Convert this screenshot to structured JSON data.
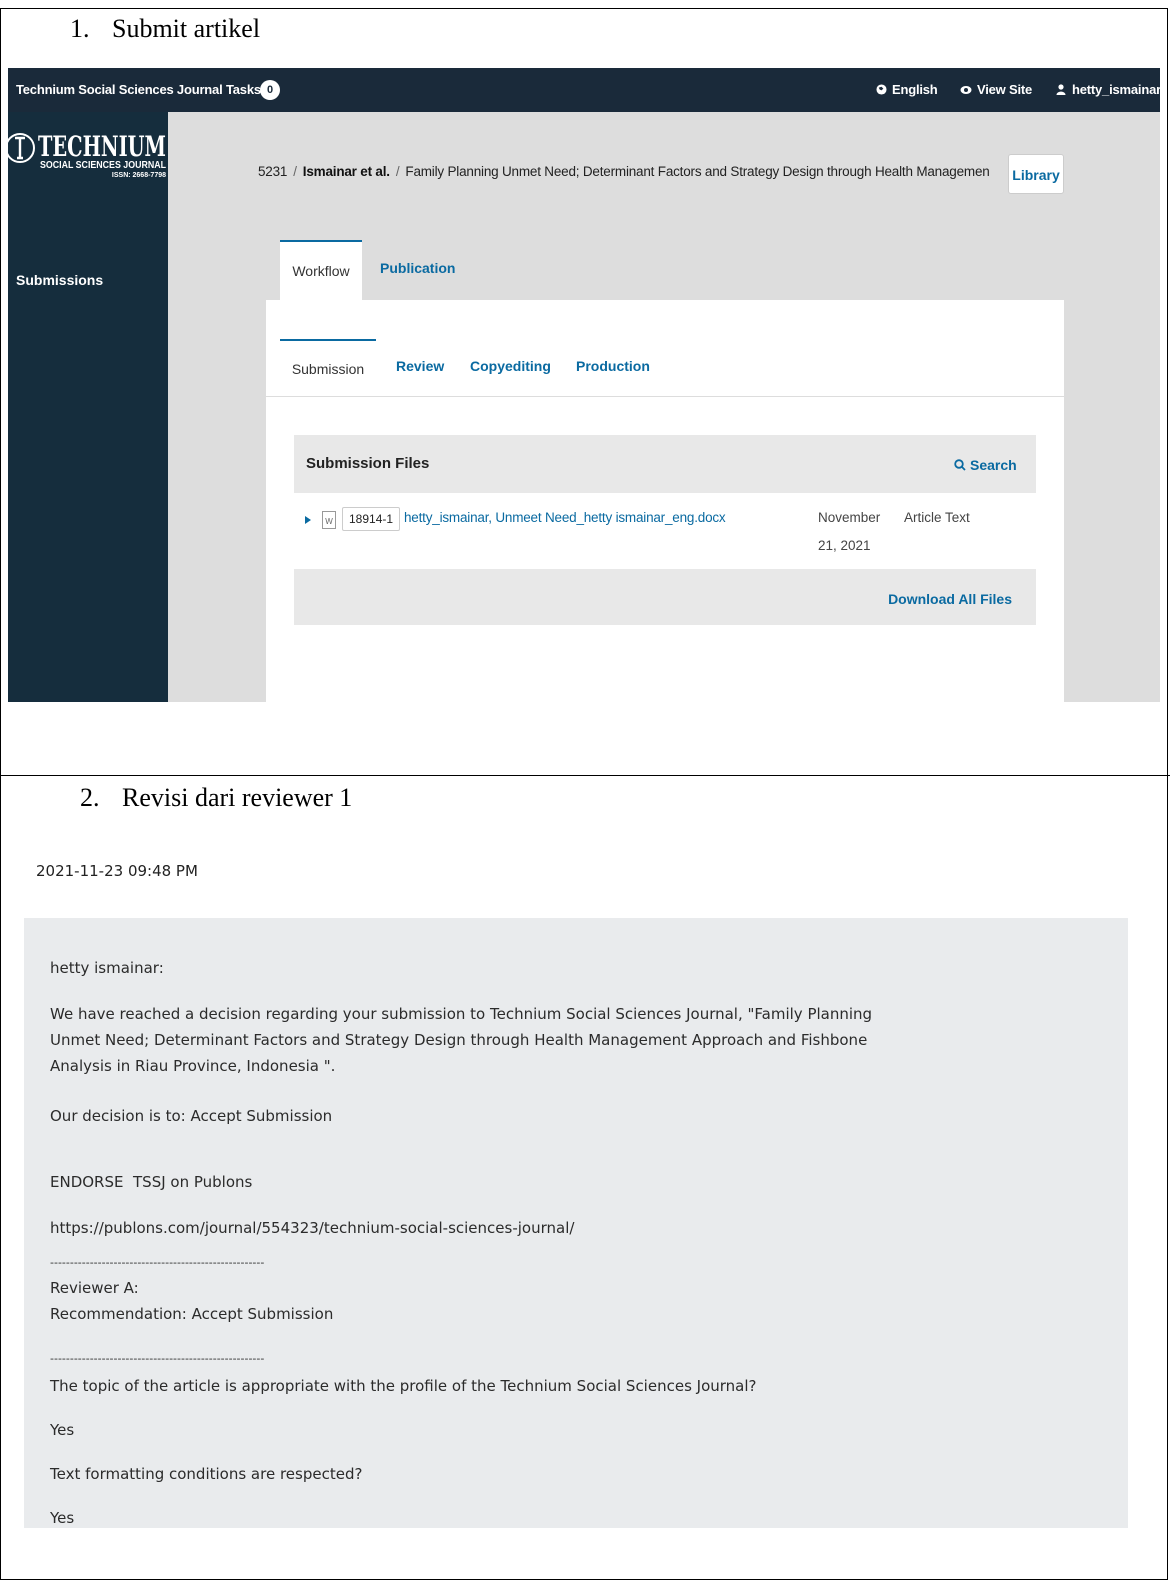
{
  "section1": {
    "number": "1.",
    "title": "Submit artikel"
  },
  "section2": {
    "number": "2.",
    "title": "Revisi dari reviewer 1"
  },
  "ojs": {
    "journal_name": "Technium Social Sciences Journal",
    "tasks_label": "Tasks",
    "tasks_count": "0",
    "lang_label": "English",
    "view_site_label": "View Site",
    "user_label": "hetty_ismainar",
    "logo": {
      "line1": "TECHNIUM",
      "line2": "SOCIAL SCIENCES JOURNAL",
      "line3": "ISSN: 2668-7798"
    },
    "sidebar_item": "Submissions",
    "breadcrumb": {
      "id": "5231",
      "authors": "Ismainar et al.",
      "title": "Family Planning Unmet Need; Determinant Factors and Strategy Design through Health Managemen"
    },
    "library_button": "Library",
    "tabs": [
      "Workflow",
      "Publication"
    ],
    "subtabs": [
      "Submission",
      "Review",
      "Copyediting",
      "Production"
    ],
    "files": {
      "heading": "Submission Files",
      "search_label": "Search",
      "row": {
        "file_id": "18914-1",
        "file_name": "hetty_ismainar, Unmeet Need_hetty ismainar_eng.docx",
        "date_line1": "November",
        "date_line2": "21, 2021",
        "type": "Article Text"
      },
      "download_all": "Download All Files"
    }
  },
  "email": {
    "timestamp": "2021-11-23 09:48 PM",
    "greeting": "hetty ismainar:",
    "body_line1": "We have reached a decision regarding your submission to Technium Social Sciences Journal, \"Family Planning",
    "body_line2": "Unmet Need; Determinant Factors and Strategy Design through Health Management Approach and Fishbone",
    "body_line3": "Analysis in Riau Province, Indonesia \".",
    "decision": "Our decision is to: Accept Submission",
    "endorse": "ENDORSE  TSSJ on Publons",
    "url": "https://publons.com/journal/554323/technium-social-sciences-journal/",
    "divider1": "------------------------------------------------------",
    "reviewer": "Reviewer A:",
    "recommendation": "Recommendation: Accept Submission",
    "divider2": "------------------------------------------------------",
    "q1": "The topic of the article is appropriate with the profile of the Technium Social Sciences Journal?",
    "a1": "Yes",
    "q2": "Text formatting conditions are respected?",
    "a2": "Yes"
  }
}
